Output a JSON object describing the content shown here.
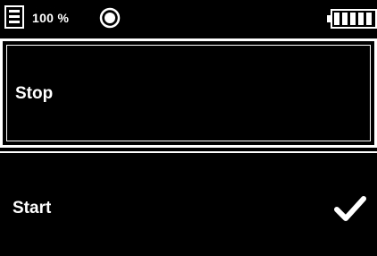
{
  "status_bar": {
    "storage_icon": "sd-card-icon",
    "storage_text": "100 %",
    "record_icon": "record-indicator-icon",
    "battery_icon": "battery-full-icon",
    "battery_level": 1.0
  },
  "menu": {
    "items": [
      {
        "label": "Stop",
        "selected": false,
        "highlighted": true
      },
      {
        "label": "Start",
        "selected": true,
        "highlighted": false,
        "check_icon": "checkmark-icon"
      }
    ]
  },
  "colors": {
    "background": "#000000",
    "foreground": "#ffffff"
  }
}
